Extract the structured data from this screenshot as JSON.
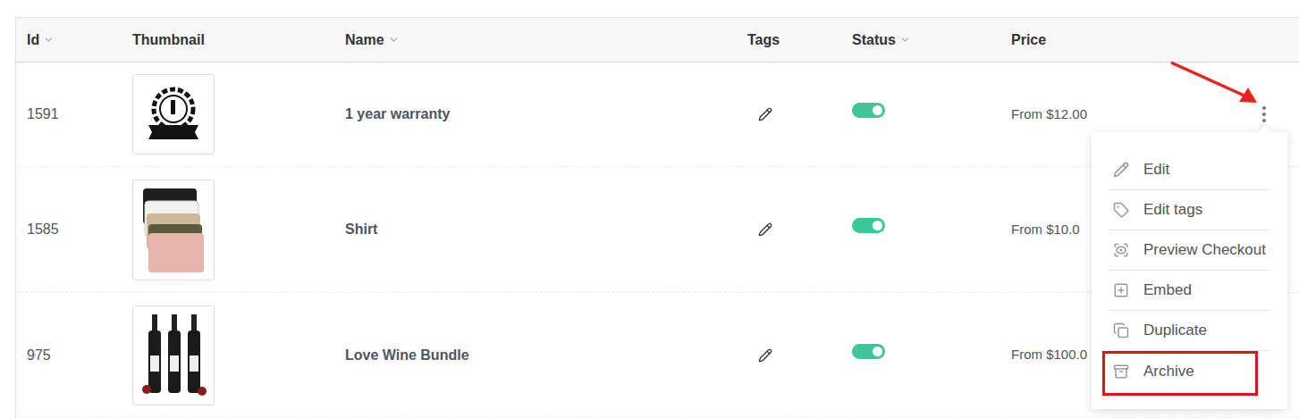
{
  "table": {
    "columns": [
      {
        "label": "Id",
        "sortable": true
      },
      {
        "label": "Thumbnail",
        "sortable": false
      },
      {
        "label": "Name",
        "sortable": true
      },
      {
        "label": "Tags",
        "sortable": false
      },
      {
        "label": "Status",
        "sortable": true
      },
      {
        "label": "Price",
        "sortable": false
      }
    ],
    "rows": [
      {
        "id": "1591",
        "name": "1 year warranty",
        "on": true,
        "price": "From $12.00",
        "menu_open": true
      },
      {
        "id": "1585",
        "name": "Shirt",
        "on": true,
        "price": "From $10.0",
        "menu_open": false
      },
      {
        "id": "975",
        "name": "Love Wine Bundle",
        "on": true,
        "price": "From $100.0",
        "menu_open": false
      }
    ]
  },
  "menu": {
    "items": [
      {
        "label": "Edit",
        "marked": false
      },
      {
        "label": "Edit tags",
        "marked": false
      },
      {
        "label": "Preview Checkout",
        "marked": false
      },
      {
        "label": "Embed",
        "marked": false
      },
      {
        "label": "Duplicate",
        "marked": false
      },
      {
        "label": "Archive",
        "marked": true
      }
    ]
  }
}
